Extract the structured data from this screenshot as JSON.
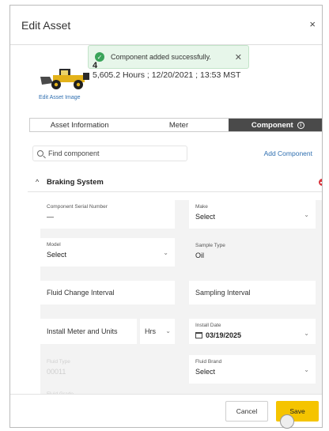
{
  "dialog": {
    "title": "Edit Asset",
    "close_label": "×"
  },
  "toast": {
    "message": "Component added successfully.",
    "close_label": "✕"
  },
  "asset": {
    "id_label": "4",
    "meter_info": "5,605.2 Hours ; 12/20/2021 ; 13:53 MST",
    "edit_image_label": "Edit Asset Image",
    "image_icon": "wheel-loader"
  },
  "tabs": [
    {
      "label": "Asset Information",
      "active": false
    },
    {
      "label": "Meter",
      "active": false
    },
    {
      "label": "Component",
      "active": true,
      "info_icon": "ⓘ"
    }
  ],
  "search": {
    "placeholder": "Find component",
    "value": ""
  },
  "add_component_label": "Add Component",
  "section": {
    "title": "Braking System",
    "caret": "^"
  },
  "fields": {
    "serial_number": {
      "label": "Component Serial Number",
      "value": "—"
    },
    "make": {
      "label": "Make",
      "value": "Select"
    },
    "model": {
      "label": "Model",
      "value": "Select"
    },
    "sample_type": {
      "label": "Sample Type",
      "value": "Oil"
    },
    "fluid_change_interval": {
      "placeholder": "Fluid Change Interval"
    },
    "sampling_interval": {
      "placeholder": "Sampling Interval"
    },
    "install_meter": {
      "placeholder": "Install Meter and Units",
      "units": "Hrs"
    },
    "install_date": {
      "label": "Install Date",
      "value": "03/19/2025"
    },
    "disabled_field": {
      "label": "Fluid Type",
      "value": "00011"
    },
    "fluid_brand": {
      "label": "Fluid Brand",
      "value": "Select"
    },
    "bottom_field": {
      "label": "Fluid Grade"
    }
  },
  "footer": {
    "cancel_label": "Cancel",
    "save_label": "Save"
  },
  "colors": {
    "accent_save": "#f5c400",
    "link": "#2f6fb0",
    "active_tab": "#4a4a4a",
    "remove": "#d9343c",
    "success": "#3aa45a"
  }
}
